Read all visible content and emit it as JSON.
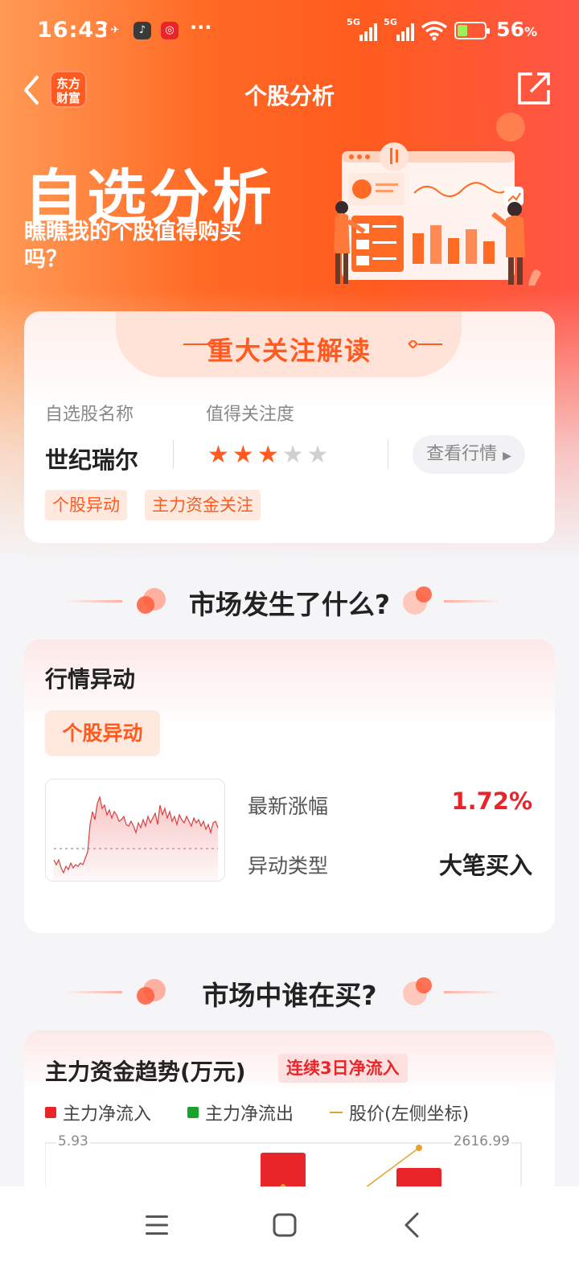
{
  "status_bar": {
    "time": "16:43",
    "more": "···",
    "net1": "5G",
    "net2": "5G",
    "battery": "56",
    "battery_unit": "%"
  },
  "nav": {
    "brand_line1": "东方",
    "brand_line2": "财富",
    "title": "个股分析"
  },
  "hero": {
    "title": "自选分析",
    "subtitle": "瞧瞧我的个股值得购买吗？"
  },
  "focus_card": {
    "title": "重大关注解读",
    "label_name": "自选股名称",
    "label_attention": "值得关注度",
    "stock_name": "世纪瑞尔",
    "rating": 3,
    "rating_max": 5,
    "view_button": "查看行情",
    "tags": [
      "个股异动",
      "主力资金关注"
    ]
  },
  "section1": {
    "title": "市场发生了什么?"
  },
  "movement_card": {
    "header": "行情异动",
    "chip": "个股异动",
    "rows": [
      {
        "label": "最新涨幅",
        "value": "1.72%",
        "color": "#e8262a"
      },
      {
        "label": "异动类型",
        "value": "大笔买入",
        "color": "#222222"
      }
    ]
  },
  "section2": {
    "title": "市场中谁在买?"
  },
  "fund_card": {
    "header": "主力资金趋势(万元)",
    "badge": "连续3日净流入",
    "legend": [
      {
        "label": "主力净流入",
        "color": "#e8262a"
      },
      {
        "label": "主力净流出",
        "color": "#1aa32a"
      },
      {
        "label": "股价(左侧坐标)",
        "color": "#e6a030"
      }
    ],
    "axis_left_top": "5.93",
    "axis_right_top": "2616.99"
  },
  "colors": {
    "accent": "#ff5a1f",
    "up": "#e8262a",
    "down": "#1aa32a"
  }
}
